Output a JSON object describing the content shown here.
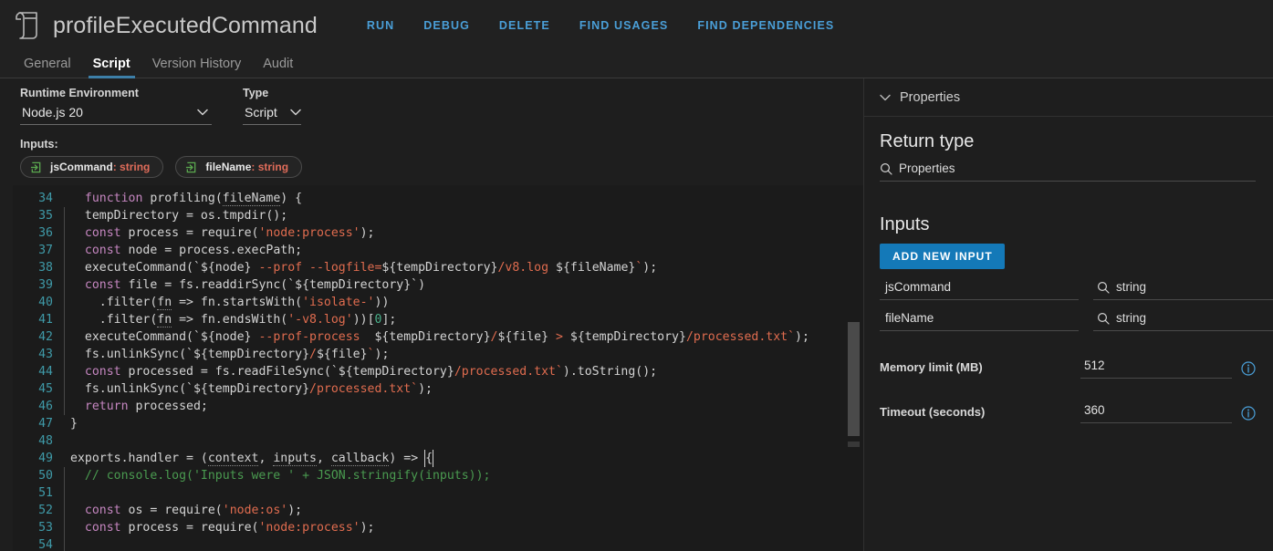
{
  "header": {
    "icon": "script-document-icon",
    "title": "profileExecutedCommand",
    "actions": [
      {
        "label": "RUN"
      },
      {
        "label": "DEBUG"
      },
      {
        "label": "DELETE"
      },
      {
        "label": "FIND USAGES"
      },
      {
        "label": "FIND DEPENDENCIES"
      }
    ],
    "tabs": [
      {
        "label": "General",
        "active": false
      },
      {
        "label": "Script",
        "active": true
      },
      {
        "label": "Version History",
        "active": false
      },
      {
        "label": "Audit",
        "active": false
      }
    ]
  },
  "editor_meta": {
    "runtime_label": "Runtime Environment",
    "runtime_value": "Node.js 20",
    "type_label": "Type",
    "type_value": "Script",
    "inputs_label": "Inputs:",
    "chips": [
      {
        "name": "jsCommand",
        "type": " : string"
      },
      {
        "name": "fileName",
        "type": " : string"
      }
    ]
  },
  "code": {
    "first_line_number": 34,
    "lines": [
      {
        "n": "34",
        "guide": false,
        "tokens": [
          {
            "t": "  ",
            "c": "plain"
          },
          {
            "t": "function ",
            "c": "kw"
          },
          {
            "t": "profiling(",
            "c": "plain"
          },
          {
            "t": "fileName",
            "c": "param"
          },
          {
            "t": ") {",
            "c": "plain"
          }
        ]
      },
      {
        "n": "35",
        "guide": true,
        "tokens": [
          {
            "t": "  tempDirectory = os.tmpdir();",
            "c": "plain"
          }
        ]
      },
      {
        "n": "36",
        "guide": true,
        "tokens": [
          {
            "t": "  ",
            "c": "plain"
          },
          {
            "t": "const ",
            "c": "kw"
          },
          {
            "t": "process = require(",
            "c": "plain"
          },
          {
            "t": "'node:process'",
            "c": "str"
          },
          {
            "t": ");",
            "c": "plain"
          }
        ]
      },
      {
        "n": "37",
        "guide": true,
        "tokens": [
          {
            "t": "  ",
            "c": "plain"
          },
          {
            "t": "const ",
            "c": "kw"
          },
          {
            "t": "node = process.execPath;",
            "c": "plain"
          }
        ]
      },
      {
        "n": "38",
        "guide": true,
        "tokens": [
          {
            "t": "  executeCommand(`${node} ",
            "c": "plain"
          },
          {
            "t": "--prof --logfile=",
            "c": "str"
          },
          {
            "t": "${tempDirectory}",
            "c": "plain"
          },
          {
            "t": "/v8.log ",
            "c": "str"
          },
          {
            "t": "${fileName}",
            "c": "plain"
          },
          {
            "t": "`",
            "c": "str"
          },
          {
            "t": ");",
            "c": "plain"
          }
        ]
      },
      {
        "n": "39",
        "guide": true,
        "tokens": [
          {
            "t": "  ",
            "c": "plain"
          },
          {
            "t": "const ",
            "c": "kw"
          },
          {
            "t": "file = fs.readdirSync(`${tempDirectory}`)",
            "c": "plain"
          }
        ]
      },
      {
        "n": "40",
        "guide": true,
        "tokens": [
          {
            "t": "    .filter(",
            "c": "plain"
          },
          {
            "t": "fn",
            "c": "param"
          },
          {
            "t": " => fn.startsWith(",
            "c": "plain"
          },
          {
            "t": "'isolate-'",
            "c": "str"
          },
          {
            "t": "))",
            "c": "plain"
          }
        ]
      },
      {
        "n": "41",
        "guide": true,
        "tokens": [
          {
            "t": "    .filter(",
            "c": "plain"
          },
          {
            "t": "fn",
            "c": "param"
          },
          {
            "t": " => fn.endsWith(",
            "c": "plain"
          },
          {
            "t": "'-v8.log'",
            "c": "str"
          },
          {
            "t": "))[",
            "c": "plain"
          },
          {
            "t": "0",
            "c": "num"
          },
          {
            "t": "];",
            "c": "plain"
          }
        ]
      },
      {
        "n": "42",
        "guide": true,
        "tokens": [
          {
            "t": "  executeCommand(`${node} ",
            "c": "plain"
          },
          {
            "t": "--prof-process",
            "c": "str"
          },
          {
            "t": "  ${tempDirectory}",
            "c": "plain"
          },
          {
            "t": "/",
            "c": "str"
          },
          {
            "t": "${file} ",
            "c": "plain"
          },
          {
            "t": "> ",
            "c": "str"
          },
          {
            "t": "${tempDirectory}",
            "c": "plain"
          },
          {
            "t": "/processed.txt`",
            "c": "str"
          },
          {
            "t": ");",
            "c": "plain"
          }
        ]
      },
      {
        "n": "43",
        "guide": true,
        "tokens": [
          {
            "t": "  fs.unlinkSync(`${tempDirectory}",
            "c": "plain"
          },
          {
            "t": "/",
            "c": "str"
          },
          {
            "t": "${file}",
            "c": "plain"
          },
          {
            "t": "`",
            "c": "str"
          },
          {
            "t": ");",
            "c": "plain"
          }
        ]
      },
      {
        "n": "44",
        "guide": true,
        "tokens": [
          {
            "t": "  ",
            "c": "plain"
          },
          {
            "t": "const ",
            "c": "kw"
          },
          {
            "t": "processed = fs.readFileSync(`${tempDirectory}",
            "c": "plain"
          },
          {
            "t": "/processed.txt`",
            "c": "str"
          },
          {
            "t": ").toString();",
            "c": "plain"
          }
        ]
      },
      {
        "n": "45",
        "guide": true,
        "tokens": [
          {
            "t": "  fs.unlinkSync(`${tempDirectory}",
            "c": "plain"
          },
          {
            "t": "/processed.txt`",
            "c": "str"
          },
          {
            "t": ");",
            "c": "plain"
          }
        ]
      },
      {
        "n": "46",
        "guide": true,
        "tokens": [
          {
            "t": "  ",
            "c": "plain"
          },
          {
            "t": "return ",
            "c": "kw"
          },
          {
            "t": "processed;",
            "c": "plain"
          }
        ]
      },
      {
        "n": "47",
        "guide": false,
        "tokens": [
          {
            "t": "}",
            "c": "plain"
          }
        ]
      },
      {
        "n": "48",
        "guide": false,
        "tokens": [
          {
            "t": "",
            "c": "plain"
          }
        ]
      },
      {
        "n": "49",
        "guide": false,
        "tokens": [
          {
            "t": "exports.handler = (",
            "c": "plain"
          },
          {
            "t": "context",
            "c": "param"
          },
          {
            "t": ", ",
            "c": "plain"
          },
          {
            "t": "inputs",
            "c": "param"
          },
          {
            "t": ", ",
            "c": "plain"
          },
          {
            "t": "callback",
            "c": "param"
          },
          {
            "t": ") => ",
            "c": "plain"
          },
          {
            "t": "{",
            "c": "caret"
          }
        ]
      },
      {
        "n": "50",
        "guide": true,
        "tokens": [
          {
            "t": "  // console.log('Inputs were ' + JSON.stringify(inputs));",
            "c": "cmt"
          }
        ]
      },
      {
        "n": "51",
        "guide": true,
        "tokens": [
          {
            "t": "",
            "c": "plain"
          }
        ]
      },
      {
        "n": "52",
        "guide": true,
        "tokens": [
          {
            "t": "  ",
            "c": "plain"
          },
          {
            "t": "const ",
            "c": "kw"
          },
          {
            "t": "os = require(",
            "c": "plain"
          },
          {
            "t": "'node:os'",
            "c": "str"
          },
          {
            "t": ");",
            "c": "plain"
          }
        ]
      },
      {
        "n": "53",
        "guide": true,
        "tokens": [
          {
            "t": "  ",
            "c": "plain"
          },
          {
            "t": "const ",
            "c": "kw"
          },
          {
            "t": "process = require(",
            "c": "plain"
          },
          {
            "t": "'node:process'",
            "c": "str"
          },
          {
            "t": ");",
            "c": "plain"
          }
        ]
      },
      {
        "n": "54",
        "guide": true,
        "tokens": [
          {
            "t": "",
            "c": "plain"
          }
        ]
      }
    ]
  },
  "properties": {
    "panel_label": "Properties",
    "return_type_title": "Return type",
    "return_type_value": "Properties",
    "inputs_title": "Inputs",
    "add_input_button": "ADD NEW INPUT",
    "inputs": [
      {
        "name": "jsCommand",
        "type": "string"
      },
      {
        "name": "fileName",
        "type": "string"
      }
    ],
    "settings": [
      {
        "label": "Memory limit (MB)",
        "value": "512"
      },
      {
        "label": "Timeout (seconds)",
        "value": "360"
      }
    ]
  },
  "colors": {
    "accent_blue": "#1479b8",
    "link_blue": "#4a9fd8",
    "bg": "#1e1e1e",
    "code_bg": "#1b1b1b",
    "keyword": "#c586c0",
    "string": "#e06c4f",
    "comment": "#4a9b50",
    "line_number": "#3f9aa8",
    "chip_type": "#e06c5a",
    "chip_icon_green": "#5aa84f"
  }
}
